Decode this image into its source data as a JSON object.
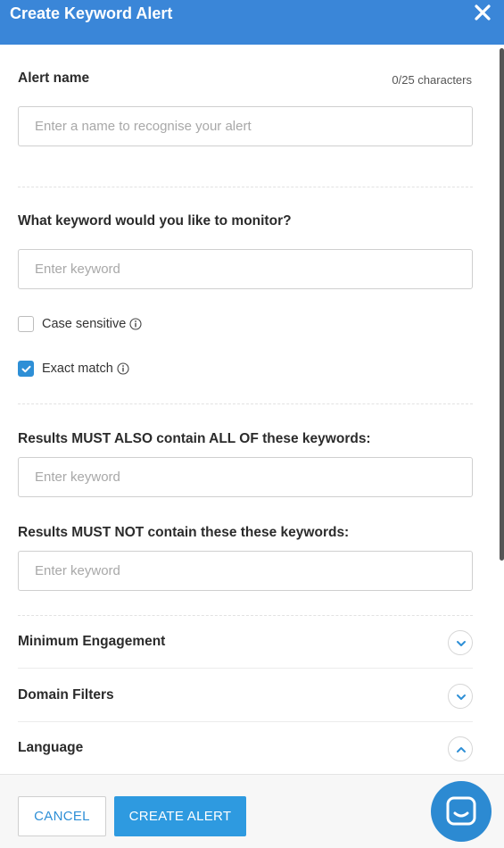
{
  "header": {
    "title": "Create Keyword Alert",
    "close_icon": "close-icon"
  },
  "alert_name": {
    "label": "Alert name",
    "counter": "0/25 characters",
    "placeholder": "Enter a name to recognise your alert",
    "value": ""
  },
  "keyword": {
    "label": "What keyword would you like to monitor?",
    "placeholder": "Enter keyword",
    "value": ""
  },
  "options": {
    "case_sensitive": {
      "label": "Case sensitive",
      "checked": false,
      "icon": "info-icon"
    },
    "exact_match": {
      "label": "Exact match",
      "checked": true,
      "icon": "info-icon"
    }
  },
  "must_also": {
    "label": "Results MUST ALSO contain ALL OF these keywords:",
    "placeholder": "Enter keyword",
    "value": ""
  },
  "must_not": {
    "label": "Results MUST NOT contain these these keywords:",
    "placeholder": "Enter keyword",
    "value": ""
  },
  "sections": [
    {
      "label": "Minimum Engagement",
      "state": "collapsed",
      "icon": "chevron-down-icon"
    },
    {
      "label": "Domain Filters",
      "state": "collapsed",
      "icon": "chevron-down-icon"
    },
    {
      "label": "Language",
      "state": "expanded",
      "icon": "chevron-up-icon"
    }
  ],
  "footer": {
    "cancel_label": "CANCEL",
    "create_label": "CREATE ALERT"
  },
  "chat": {
    "icon": "chat-icon"
  },
  "colors": {
    "header_bg": "#3a86d8",
    "accent": "#2e9ae0",
    "check_bg": "#2e8fd6"
  }
}
